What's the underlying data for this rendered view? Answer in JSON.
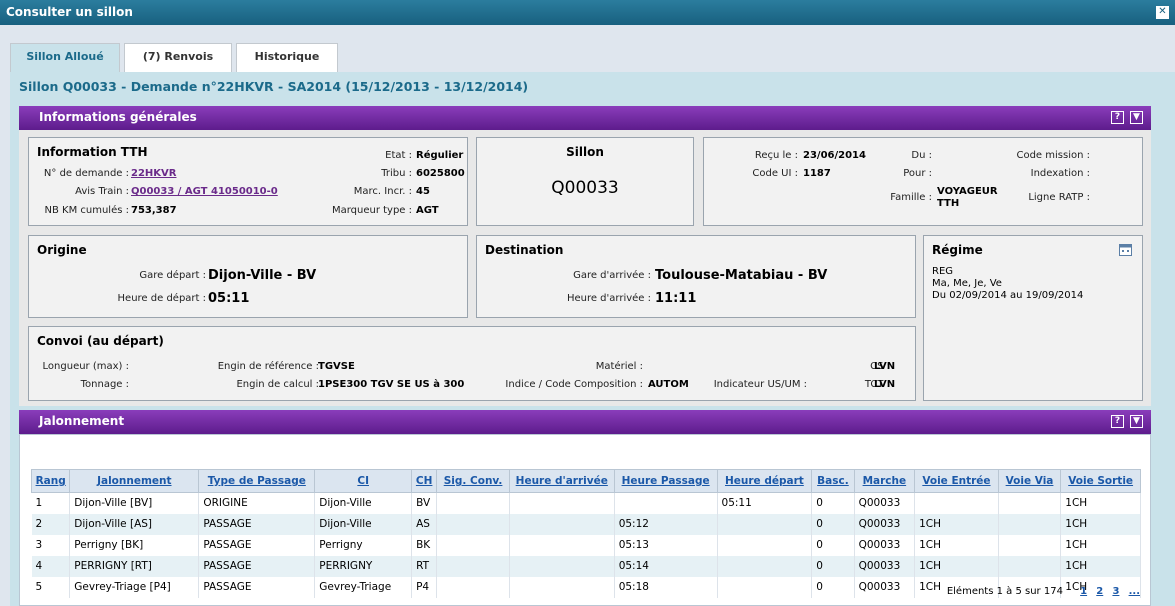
{
  "window": {
    "title": "Consulter un sillon",
    "close_glyph": "✕"
  },
  "tabs": [
    {
      "label": "Sillon Alloué"
    },
    {
      "label": "(7) Renvois"
    },
    {
      "label": "Historique"
    }
  ],
  "sillon_title": "Sillon Q00033 - Demande n°22HKVR - SA2014 (15/12/2013 - 13/12/2014)",
  "info_panel": {
    "title": "Informations générales",
    "help_glyph": "?",
    "collapse_glyph": "▼"
  },
  "info_tth": {
    "title": "Information TTH",
    "demande_label": "N° de demande :",
    "demande_value": "22HKVR",
    "avis_label": "Avis Train :",
    "avis_value": "Q00033 / AGT 41050010-0",
    "km_label": "NB KM cumulés :",
    "km_value": "753,387",
    "etat_label": "Etat :",
    "etat_value": "Régulier",
    "tribu_label": "Tribu :",
    "tribu_value": "6025800",
    "marc_label": "Marc. Incr. :",
    "marc_value": "45",
    "marqueur_label": "Marqueur type :",
    "marqueur_value": "AGT"
  },
  "sillon_box": {
    "title": "Sillon",
    "value": "Q00033"
  },
  "recu": {
    "recu_label": "Reçu le :",
    "recu_value": "23/06/2014",
    "code_ui_label": "Code UI :",
    "code_ui_value": "1187",
    "du_label": "Du :",
    "pour_label": "Pour :",
    "famille_label": "Famille :",
    "famille_value_1": "VOYAGEUR",
    "famille_value_2": "TTH",
    "code_mission_label": "Code mission :",
    "indexation_label": "Indexation :",
    "ligne_ratp_label": "Ligne RATP :"
  },
  "origine": {
    "title": "Origine",
    "gare_label": "Gare départ :",
    "gare_value": "Dijon-Ville - BV",
    "heure_label": "Heure de départ :",
    "heure_value": "05:11"
  },
  "destination": {
    "title": "Destination",
    "gare_label": "Gare d'arrivée :",
    "gare_value": "Toulouse-Matabiau - BV",
    "heure_label": "Heure d'arrivée :",
    "heure_value": "11:11"
  },
  "regime": {
    "title": "Régime",
    "icon": "calendar-icon",
    "line1": "REG",
    "line2": "Ma, Me, Je, Ve",
    "line3": "Du 02/09/2014 au 19/09/2014"
  },
  "convoi": {
    "title": "Convoi (au départ)",
    "longueur_label": "Longueur (max) :",
    "tonnage_label": "Tonnage :",
    "engin_ref_label": "Engin de référence :",
    "engin_ref_value": "TGVSE",
    "engin_calc_label": "Engin de calcul :",
    "engin_calc_value": "1PSE300 TGV SE US à 300",
    "materiel_label": "Matériel :",
    "indice_label": "Indice / Code Composition :",
    "indice_value": "AUTOM",
    "indicateur_label": "Indicateur US/UM :",
    "cs_label": "CS :",
    "cs_value": "LVN",
    "tct_label": "TCT :",
    "tct_value": "LVN"
  },
  "jalonnement": {
    "title": "Jalonnement",
    "columns": [
      "Rang",
      "Jalonnement",
      "Type de Passage",
      "CI",
      "CH",
      "Sig. Conv.",
      "Heure d'arrivée",
      "Heure Passage",
      "Heure départ",
      "Basc.",
      "Marche",
      "Voie Entrée",
      "Voie Via",
      "Voie Sortie"
    ],
    "rows": [
      [
        "1",
        "Dijon-Ville [BV]",
        "ORIGINE",
        "Dijon-Ville",
        "BV",
        "",
        "",
        "",
        "05:11",
        "0",
        "Q00033",
        "",
        "",
        "1CH"
      ],
      [
        "2",
        "Dijon-Ville [AS]",
        "PASSAGE",
        "Dijon-Ville",
        "AS",
        "",
        "",
        "05:12",
        "",
        "0",
        "Q00033",
        "1CH",
        "",
        "1CH"
      ],
      [
        "3",
        "Perrigny [BK]",
        "PASSAGE",
        "Perrigny",
        "BK",
        "",
        "",
        "05:13",
        "",
        "0",
        "Q00033",
        "1CH",
        "",
        "1CH"
      ],
      [
        "4",
        "PERRIGNY [RT]",
        "PASSAGE",
        "PERRIGNY",
        "RT",
        "",
        "",
        "05:14",
        "",
        "0",
        "Q00033",
        "1CH",
        "",
        "1CH"
      ],
      [
        "5",
        "Gevrey-Triage [P4]",
        "PASSAGE",
        "Gevrey-Triage",
        "P4",
        "",
        "",
        "05:18",
        "",
        "0",
        "Q00033",
        "1CH",
        "",
        "1CH"
      ]
    ],
    "pager": {
      "summary": "Eléments 1 à 5 sur 174",
      "pages": [
        "1",
        "2",
        "3",
        "..."
      ]
    }
  }
}
